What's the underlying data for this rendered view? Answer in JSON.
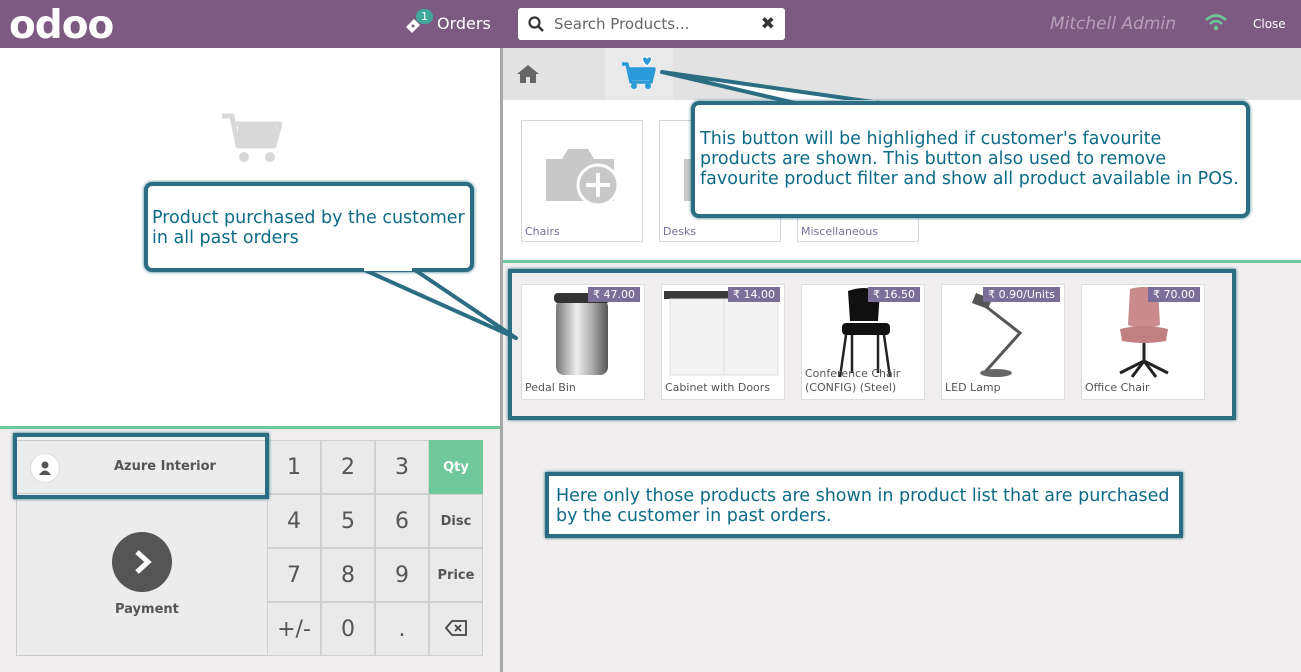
{
  "header": {
    "logo": "odoo",
    "orders_count": "1",
    "orders_label": "Orders",
    "search_placeholder": "Search Products...",
    "user": "Mitchell Admin",
    "close_label": "Close"
  },
  "order_panel": {
    "customer_name": "Azure Interior",
    "payment_label": "Payment"
  },
  "numpad": {
    "keys": [
      "1",
      "2",
      "3",
      "Qty",
      "4",
      "5",
      "6",
      "Disc",
      "7",
      "8",
      "9",
      "Price",
      "+/-",
      "0",
      "."
    ],
    "active_mode": "Qty"
  },
  "categories": [
    {
      "name": "Chairs"
    },
    {
      "name": "Desks"
    },
    {
      "name": "Miscellaneous"
    }
  ],
  "products": [
    {
      "name": "Pedal Bin",
      "price": "₹ 47.00"
    },
    {
      "name": "Cabinet with Doors",
      "price": "₹ 14.00"
    },
    {
      "name": "Conference Chair (CONFIG) (Steel)",
      "price": "₹ 16.50"
    },
    {
      "name": "LED Lamp",
      "price": "₹ 0.90/Units"
    },
    {
      "name": "Office Chair",
      "price": "₹ 70.00"
    }
  ],
  "callouts": {
    "past_orders": "Product purchased by the customer in all past orders",
    "fav_button": "This button will be highlighed if customer's favourite products are shown. This button also used to remove favourite product filter and show all product available in POS.",
    "product_list": "Here only those products are shown in product list that are purchased by the customer in past orders."
  },
  "colors": {
    "header_bg": "#7c5a81",
    "accent_green": "#6ec89b",
    "callout_border": "#2b6e84",
    "callout_text": "#0e6b88",
    "price_tag": "#7b6f9a"
  }
}
